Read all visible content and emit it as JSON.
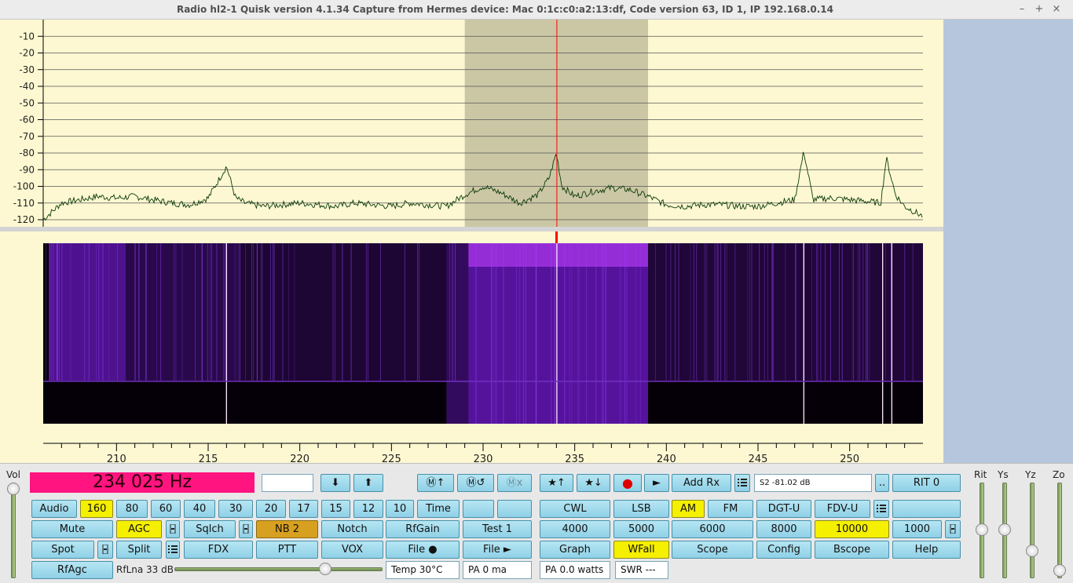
{
  "window": {
    "title": "Radio hl2-1   Quisk version 4.1.34   Capture from Hermes device: Mac  0:1c:c0:a2:13:df, Code version 63, ID 1, IP 192.168.0.14",
    "minimize": "–",
    "maximize": "+",
    "close": "×"
  },
  "spectrum": {
    "y_ticks": [
      "-10",
      "-20",
      "-30",
      "-40",
      "-50",
      "-60",
      "-70",
      "-80",
      "-90",
      "-100",
      "-110",
      "-120"
    ],
    "passband_khz": [
      229,
      239
    ],
    "center_khz": 234.025
  },
  "chart_data": {
    "type": "line",
    "title": "",
    "xlabel": "",
    "ylabel": "",
    "xlim": [
      206,
      254
    ],
    "ylim": [
      -125,
      0
    ],
    "x_ticks": [
      "210",
      "215",
      "220",
      "225",
      "230",
      "235",
      "240",
      "245",
      "250"
    ],
    "x_tick_values": [
      210,
      215,
      220,
      225,
      230,
      235,
      240,
      245,
      250
    ],
    "series": [
      {
        "values_khz": [
          206,
          207,
          208,
          209,
          210,
          211,
          212,
          213,
          214,
          215,
          216,
          216.5,
          217,
          218,
          219,
          220,
          221,
          222,
          223,
          224,
          225,
          226,
          227,
          228,
          229,
          230,
          231,
          232,
          233,
          233.6,
          234,
          234.3,
          235,
          236,
          237,
          238,
          239,
          240,
          241,
          242,
          243,
          244,
          245,
          246,
          247,
          247.5,
          248,
          249,
          250,
          251,
          251.7,
          252,
          252.5,
          253,
          254
        ],
        "values_db": [
          -120,
          -110,
          -108,
          -106,
          -107,
          -106,
          -108,
          -110,
          -111,
          -107,
          -88,
          -107,
          -110,
          -112,
          -111,
          -110,
          -111,
          -112,
          -110,
          -111,
          -112,
          -110,
          -111,
          -112,
          -105,
          -100,
          -104,
          -110,
          -105,
          -95,
          -80,
          -100,
          -106,
          -103,
          -101,
          -102,
          -106,
          -111,
          -112,
          -111,
          -111,
          -112,
          -112,
          -110,
          -108,
          -79,
          -108,
          -107,
          -108,
          -109,
          -110,
          -83,
          -105,
          -112,
          -118
        ]
      }
    ],
    "grid": true,
    "legend": "none"
  },
  "display": {
    "frequency": "234 025 Hz",
    "smeter": "S2    -81.02  dB"
  },
  "buttons": {
    "mem_up": "Ⓜ↑",
    "mem_recall": "Ⓜ↺",
    "mem_x": "Ⓜx",
    "fav_up": "★↑",
    "fav_down": "★↓",
    "record": "●",
    "play": "►",
    "add_rx": "Add Rx",
    "more": "..",
    "rit": "RIT 0",
    "down": "⬇",
    "up": "⬆",
    "audio": "Audio",
    "b160": "160",
    "b80": "80",
    "b60": "60",
    "b40": "40",
    "b30": "30",
    "b20": "20",
    "b17": "17",
    "b15": "15",
    "b12": "12",
    "b10": "10",
    "time": "Time",
    "cwl": "CWL",
    "lsb": "LSB",
    "am": "AM",
    "fm": "FM",
    "dgtu": "DGT-U",
    "fdvu": "FDV-U",
    "mute": "Mute",
    "agc": "AGC",
    "sqlch": "Sqlch",
    "nb2": "NB 2",
    "notch": "Notch",
    "rfgain": "RfGain",
    "test1": "Test 1",
    "f4000": "4000",
    "f5000": "5000",
    "f6000": "6000",
    "f8000": "8000",
    "f10000": "10000",
    "f1000": "1000",
    "spot": "Spot",
    "split": "Split",
    "fdx": "FDX",
    "ptt": "PTT",
    "vox": "VOX",
    "file_rec": "File ●",
    "file_play": "File ►",
    "graph": "Graph",
    "wfall": "WFall",
    "scope": "Scope",
    "config": "Config",
    "bscope": "Bscope",
    "help": "Help",
    "rfagc": "RfAgc"
  },
  "status": {
    "rflna": "RfLna 33 dB",
    "temp": "Temp  30°C",
    "pa_current": "PA    0 ma",
    "pa_power": "PA 0.0 watts",
    "swr": "SWR  ---"
  },
  "sliders": {
    "vol": "Vol",
    "rit": "Rit",
    "ys": "Ys",
    "yz": "Yz",
    "zo": "Zo"
  },
  "colors": {
    "background": "#fdf8d2",
    "freq_display": "#ff1480",
    "button": "#9ad6ea",
    "button_on": "#f5ef00",
    "waterfall_signal": "#8a20ff",
    "cursor": "#ff0000"
  }
}
